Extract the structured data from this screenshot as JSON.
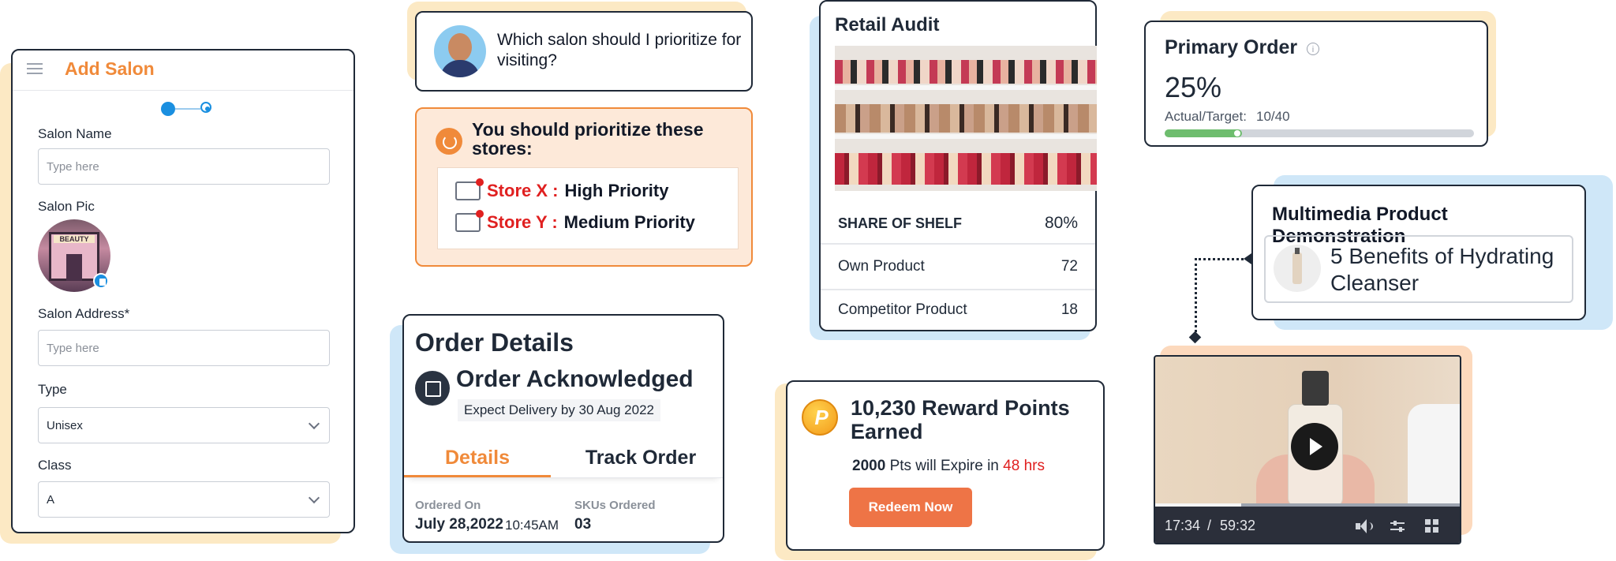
{
  "add_salon": {
    "title": "Add Salon",
    "salon_name_label": "Salon Name",
    "salon_name_placeholder": "Type here",
    "salon_pic_label": "Salon Pic",
    "salon_sign_text": "BEAUTY",
    "salon_address_label": "Salon Address*",
    "salon_address_placeholder": "Type here",
    "type_label": "Type",
    "type_value": "Unisex",
    "class_label": "Class",
    "class_value": "A"
  },
  "chat": {
    "question": "Which salon should I prioritize for visiting?",
    "answer_title": "You should prioritize these stores:",
    "stores": [
      {
        "name": "Store X :",
        "priority": "High Priority"
      },
      {
        "name": "Store Y :",
        "priority": "Medium Priority"
      }
    ]
  },
  "retail_audit": {
    "title": "Retail Audit",
    "share_label": "SHARE OF SHELF",
    "share_value": "80%",
    "rows": [
      {
        "label": "Own Product",
        "value": "72"
      },
      {
        "label": "Competitor Product",
        "value": "18"
      }
    ]
  },
  "primary_order": {
    "title": "Primary Order",
    "percent": "25%",
    "actual_label": "Actual/Target:",
    "actual_value": "10/40",
    "progress_fraction": 0.25
  },
  "multimedia": {
    "title": "Multimedia Product Demonstration",
    "item_title": "5 Benefits of Hydrating Cleanser"
  },
  "order_details": {
    "title": "Order Details",
    "status": "Order Acknowledged",
    "delivery": "Expect Delivery by 30 Aug 2022",
    "tabs": [
      "Details",
      "Track Order"
    ],
    "ordered_on_label": "Ordered On",
    "ordered_on_date": "July 28,2022",
    "ordered_on_time": "10:45AM",
    "skus_label": "SKUs Ordered",
    "skus_value": "03"
  },
  "reward": {
    "coin_letter": "P",
    "title": "10,230 Reward Points Earned",
    "expire_points": "2000",
    "expire_text": "Pts will Expire in",
    "expire_hours": "48 hrs",
    "button": "Redeem Now"
  },
  "video": {
    "time_current": "17:34",
    "separator": "/",
    "time_total": "59:32",
    "progress_fraction": 0.28
  },
  "colors": {
    "accent_orange": "#f08a3a",
    "blue": "#1a8fe0",
    "green": "#6ebd6e",
    "red": "#e02020",
    "button": "#ee7446"
  }
}
